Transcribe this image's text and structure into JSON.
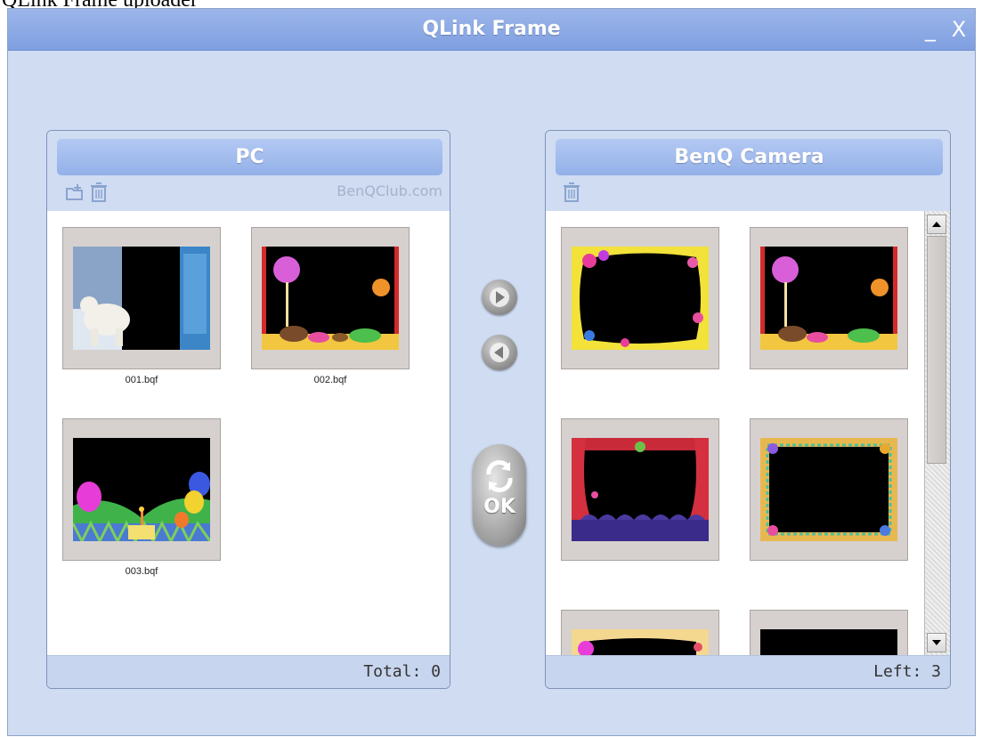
{
  "page": {
    "caption": "QLink Frame uploader"
  },
  "window": {
    "title": "QLink Frame",
    "minimize_glyph": "_",
    "close_glyph": "X"
  },
  "pc_panel": {
    "title": "PC",
    "club_label": "BenQClub.com",
    "icons": [
      "import-folder-icon",
      "trash-icon"
    ],
    "files": [
      {
        "name": "001.bqf",
        "art": "polar-bear-window"
      },
      {
        "name": "002.bqf",
        "art": "candy-lollipop"
      },
      {
        "name": "003.bqf",
        "art": "balloons-party"
      }
    ],
    "footer": "Total: 0"
  },
  "camera_panel": {
    "title": "BenQ Camera",
    "icons": [
      "trash-icon"
    ],
    "frames": [
      {
        "art": "yellow-flower-border"
      },
      {
        "art": "candy-lollipop"
      },
      {
        "art": "theater-curtain"
      },
      {
        "art": "green-stitched-border"
      },
      {
        "art": "pink-flower-border"
      },
      {
        "art": "plain-border"
      }
    ],
    "footer": "Left: 3"
  },
  "controls": {
    "transfer_right_icon": "arrow-right-icon",
    "transfer_left_icon": "arrow-left-icon",
    "ok_label": "OK",
    "ok_icon": "refresh-icon"
  },
  "colors": {
    "window_bg": "#cfdcf2",
    "header_blue": "#93b0e8",
    "titlebar_blue": "#7f9fe0"
  }
}
